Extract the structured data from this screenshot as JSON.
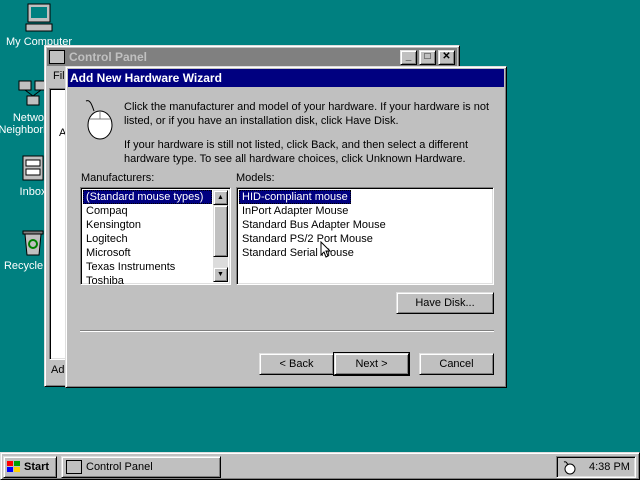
{
  "desktop": {
    "icons": [
      {
        "label": "My Computer"
      },
      {
        "label": "Network Neighborhood"
      },
      {
        "label": "Inbox"
      },
      {
        "label": "Recycle Bin"
      }
    ]
  },
  "control_panel": {
    "title": "Control Panel",
    "menu_first": "File",
    "status_text": "Add",
    "side_text": "A"
  },
  "wizard": {
    "title": "Add New Hardware Wizard",
    "instruction1": "Click the manufacturer and model of your hardware. If your hardware is not listed, or if you have an installation disk, click Have Disk.",
    "instruction2": "If your hardware is still not listed, click Back, and then select a different hardware type. To see all hardware choices, click Unknown Hardware.",
    "manufacturers_label": "Manufacturers:",
    "models_label": "Models:",
    "manufacturers": [
      "(Standard mouse types)",
      "Compaq",
      "Kensington",
      "Logitech",
      "Microsoft",
      "Texas Instruments",
      "Toshiba"
    ],
    "selected_manufacturer": "(Standard mouse types)",
    "models": [
      "HID-compliant mouse",
      "InPort Adapter Mouse",
      "Standard Bus Adapter Mouse",
      "Standard PS/2 Port Mouse",
      "Standard Serial Mouse"
    ],
    "selected_model": "HID-compliant mouse",
    "have_disk_label": "Have Disk...",
    "back_label": "< Back",
    "next_label": "Next >",
    "cancel_label": "Cancel"
  },
  "taskbar": {
    "start_label": "Start",
    "task_label": "Control Panel",
    "clock": "4:38 PM"
  },
  "colors": {
    "desktop": "#008080",
    "active_title": "#000080",
    "inactive_title": "#808080",
    "face": "#c0c0c0"
  }
}
